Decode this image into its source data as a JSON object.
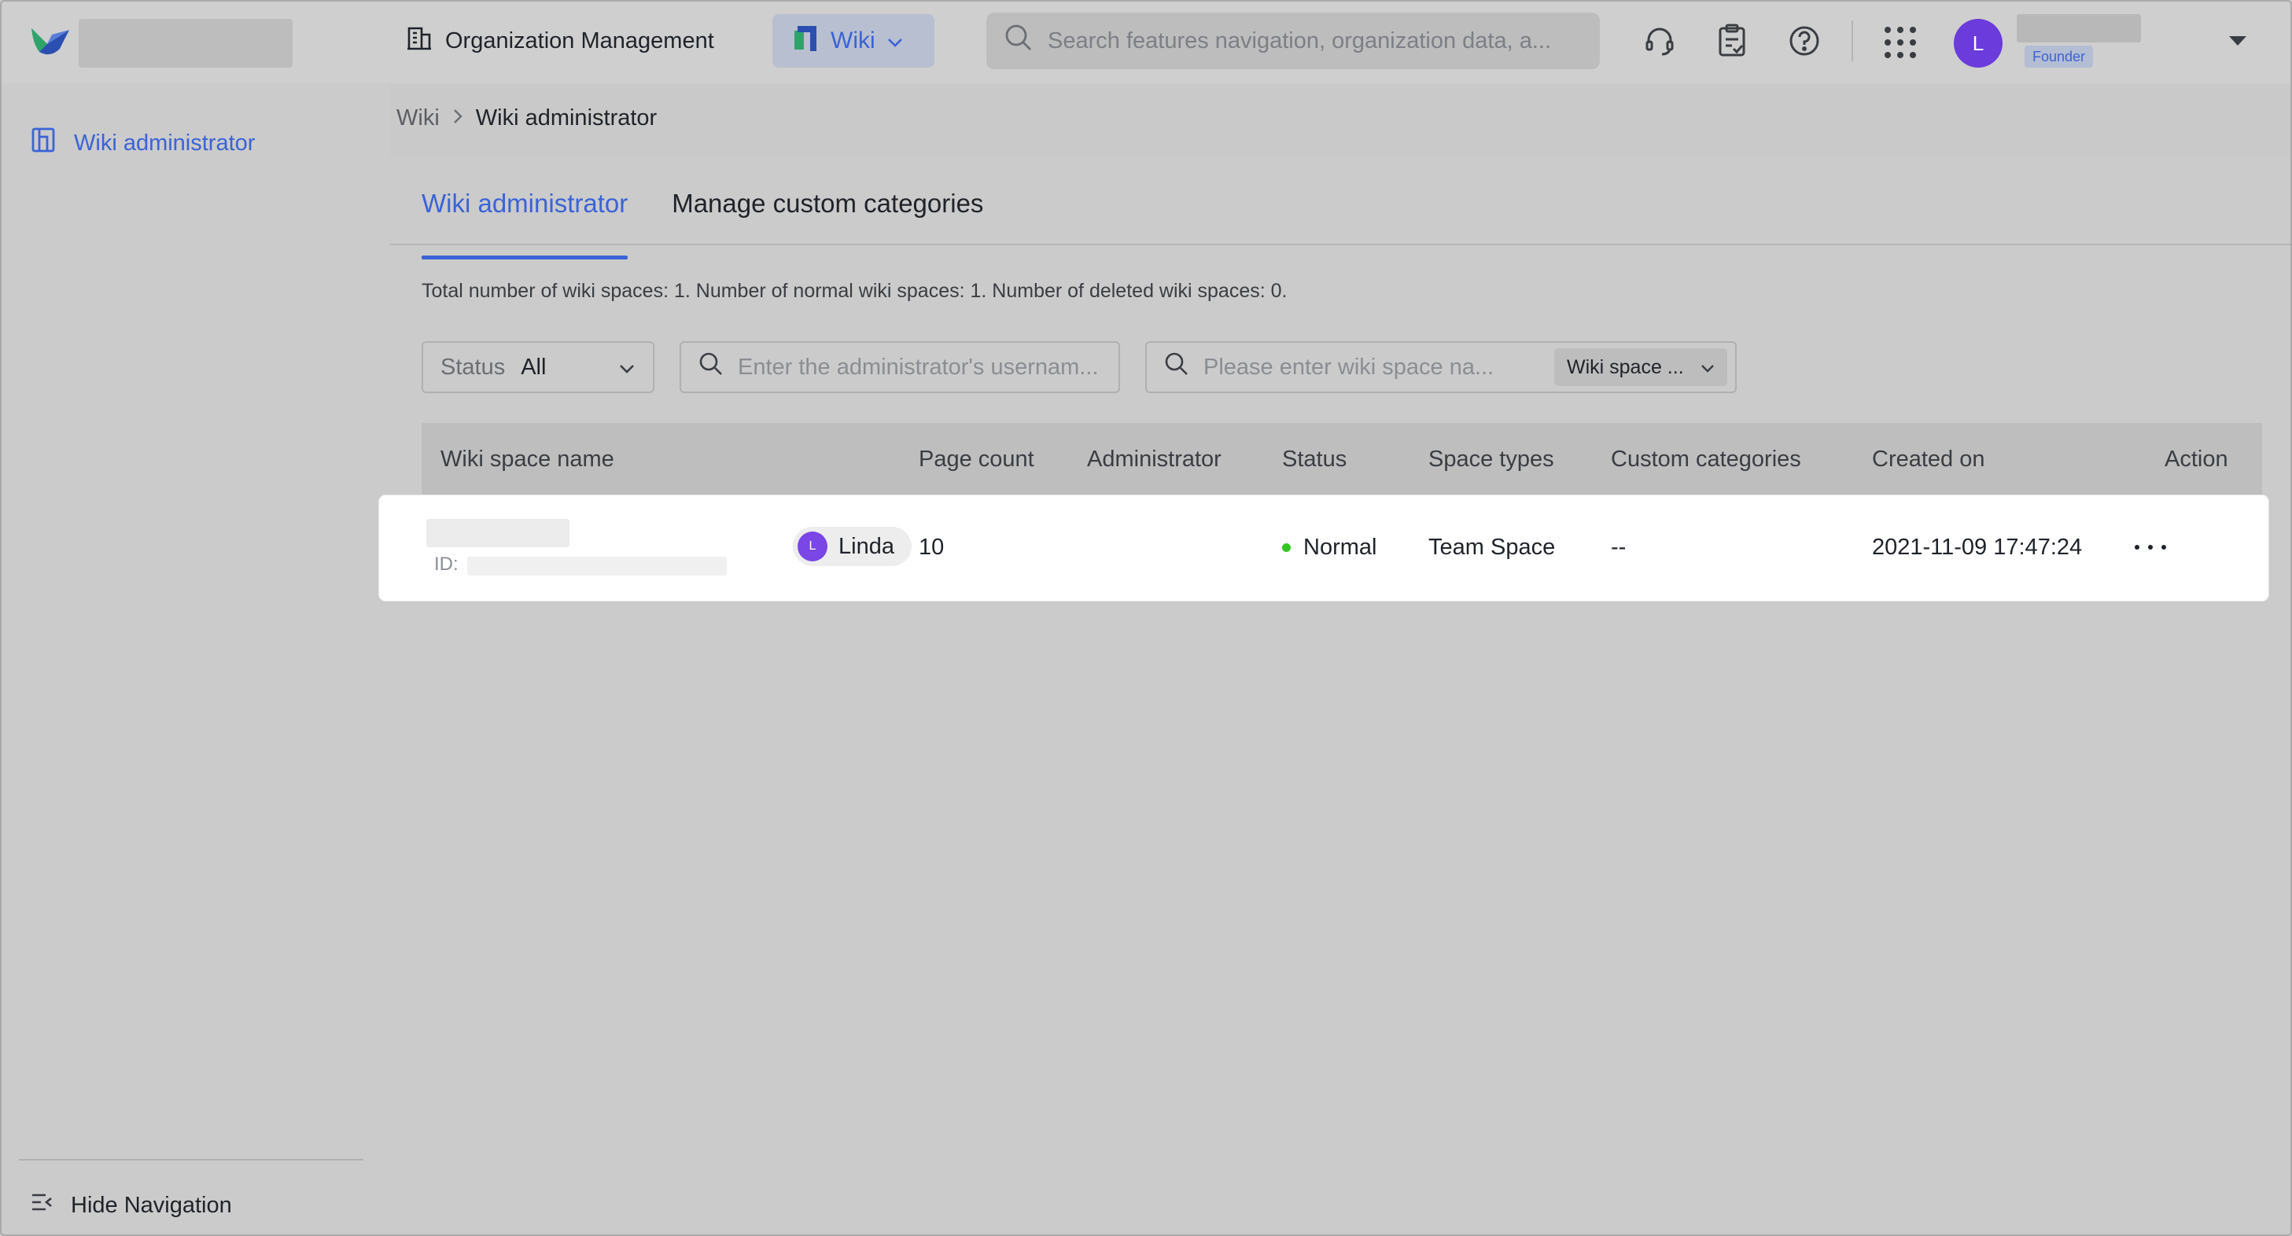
{
  "header": {
    "org_label": "Organization Management",
    "app_switch_label": "Wiki",
    "search_placeholder": "Search features navigation, organization data, a...",
    "avatar_initial": "L",
    "role_badge": "Founder"
  },
  "sidebar": {
    "items": [
      {
        "label": "Wiki administrator"
      }
    ],
    "hide_nav_label": "Hide Navigation"
  },
  "breadcrumb": {
    "parent": "Wiki",
    "current": "Wiki administrator"
  },
  "tabs": [
    {
      "label": "Wiki administrator",
      "active": true
    },
    {
      "label": "Manage custom categories",
      "active": false
    }
  ],
  "summary": "Total number of wiki spaces: 1. Number of normal wiki spaces: 1. Number of deleted wiki spaces: 0.",
  "filters": {
    "status_label": "Status",
    "status_value": "All",
    "admin_placeholder": "Enter the administrator's usernam...",
    "space_placeholder": "Please enter wiki space na...",
    "space_type_value": "Wiki space ..."
  },
  "table": {
    "columns": [
      "Wiki space name",
      "Page count",
      "Administrator",
      "Status",
      "Space types",
      "Custom categories",
      "Created on",
      "Action"
    ],
    "rows": [
      {
        "id_label": "ID:",
        "page_count": "10",
        "admin_initial": "L",
        "admin_name": "Linda",
        "status": "Normal",
        "space_type": "Team Space",
        "custom_categories": "--",
        "created_on": "2021-11-09 17:47:24"
      }
    ]
  },
  "colors": {
    "accent": "#3b63d6",
    "avatar": "#6b3bdc",
    "status_normal": "#34c724"
  }
}
